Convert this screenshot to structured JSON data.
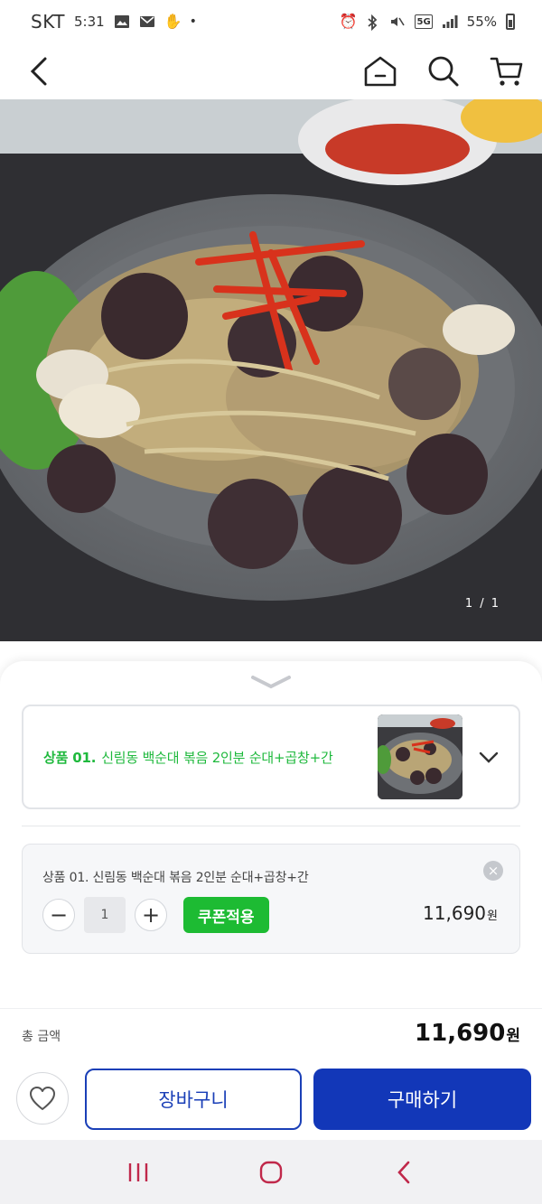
{
  "status_bar": {
    "carrier": "SKT",
    "time": "5:31",
    "battery": "55%",
    "network": "5G",
    "icons": [
      "image-icon",
      "mail-icon",
      "hand-icon",
      "dot-icon",
      "alarm-icon",
      "bluetooth-icon",
      "mute-icon",
      "signal-icon",
      "battery-icon"
    ]
  },
  "top_nav": {
    "icons": [
      "back-icon",
      "home-icon",
      "search-icon",
      "cart-icon"
    ]
  },
  "product_image": {
    "counter": "1 / 1"
  },
  "option_select": {
    "prefix": "상품 01.",
    "label": "신림동 백순대 볶음 2인분 순대+곱창+간"
  },
  "selected_item": {
    "name": "상품 01. 신림동 백순대 볶음 2인분 순대+곱창+간",
    "quantity": "1",
    "coupon_label": "쿠폰적용",
    "price": "11,690",
    "price_unit": "원"
  },
  "total": {
    "label": "총 금액",
    "price": "11,690",
    "unit": "원"
  },
  "actions": {
    "cart_label": "장바구니",
    "buy_label": "구매하기"
  },
  "colors": {
    "accent_green": "#1dbb33",
    "primary_blue": "#1237b8"
  }
}
